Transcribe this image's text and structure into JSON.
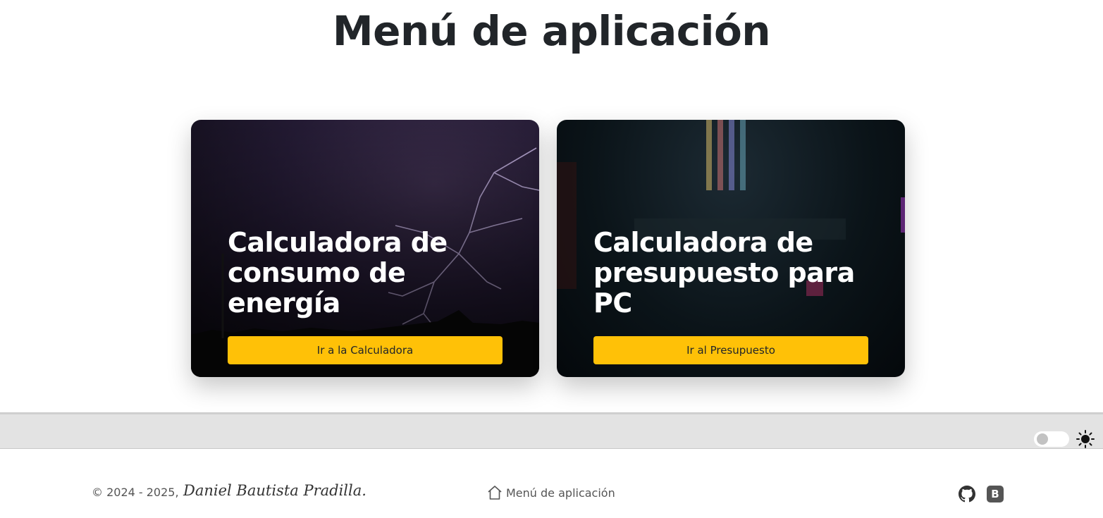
{
  "page": {
    "title": "Menú de aplicación"
  },
  "cards": [
    {
      "title": "Calculadora de consumo de energía",
      "button_label": "Ir a la Calculadora",
      "background": "lightning-storm-night-photo"
    },
    {
      "title": "Calculadora de presupuesto para PC",
      "button_label": "Ir al Presupuesto",
      "background": "pc-hardware-rgb-photo"
    }
  ],
  "toolbar": {
    "theme_toggle_icon": "sun-icon",
    "theme_toggle_state": "off"
  },
  "footer": {
    "copyright": "© 2024 - 2025,",
    "author": "Daniel Bautista Pradilla.",
    "home_link_label": "Menú de aplicación",
    "home_icon": "home-icon",
    "social_icons": [
      "github-icon",
      "bootstrap-icon"
    ]
  },
  "colors": {
    "accent": "#ffc107",
    "title_text": "#212529",
    "toolbar_bg": "#e3e3e3",
    "footer_text": "#555555"
  }
}
